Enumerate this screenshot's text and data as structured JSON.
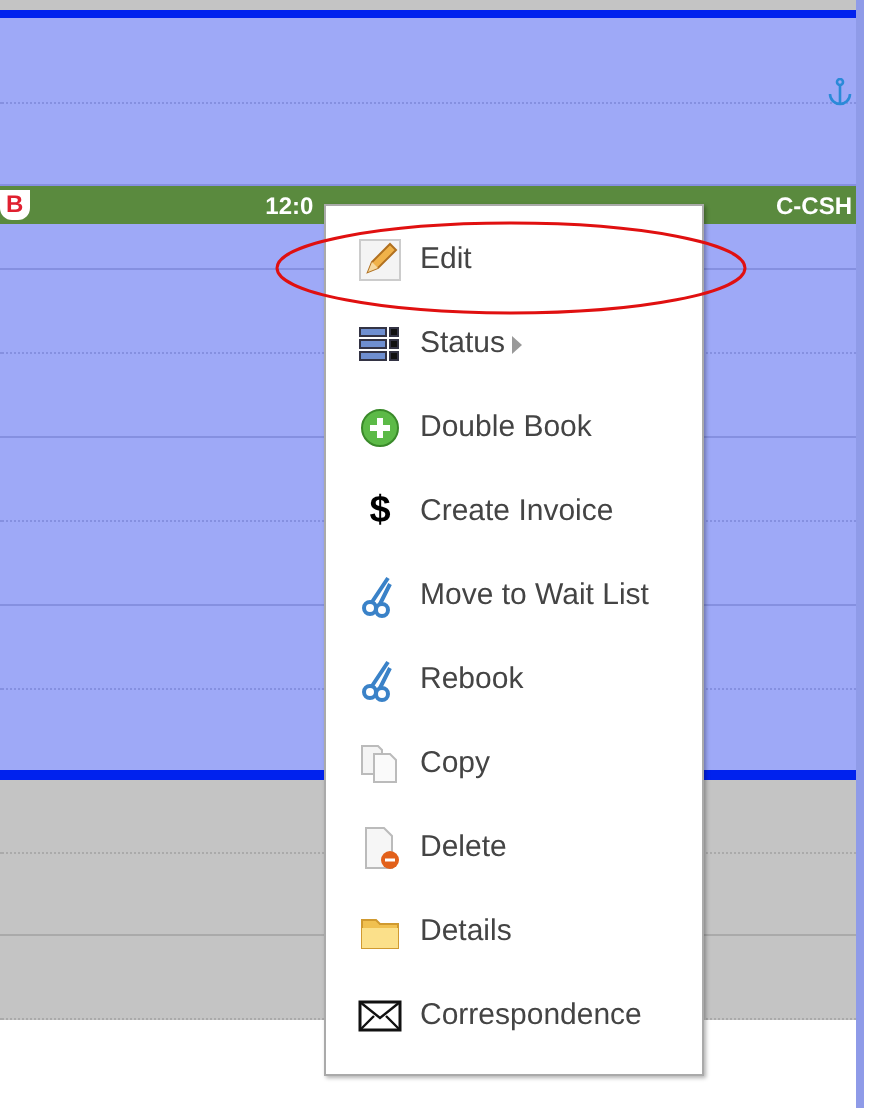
{
  "appointment": {
    "badge": "B",
    "start_time": "12:0",
    "code": "C-CSH"
  },
  "context_menu": {
    "items": [
      {
        "label": "Edit",
        "kind": "pencil",
        "has_submenu": false,
        "circled": true
      },
      {
        "label": "Status",
        "kind": "status",
        "has_submenu": true,
        "circled": false
      },
      {
        "label": "Double Book",
        "kind": "plus",
        "has_submenu": false,
        "circled": false
      },
      {
        "label": "Create Invoice",
        "kind": "glyph",
        "glyph": "$",
        "has_submenu": false,
        "circled": false
      },
      {
        "label": "Move to Wait List",
        "kind": "scissors",
        "has_submenu": false,
        "circled": false
      },
      {
        "label": "Rebook",
        "kind": "scissors",
        "has_submenu": false,
        "circled": false
      },
      {
        "label": "Copy",
        "kind": "copy",
        "has_submenu": false,
        "circled": false
      },
      {
        "label": "Delete",
        "kind": "delete",
        "has_submenu": false,
        "circled": false
      },
      {
        "label": "Details",
        "kind": "folder",
        "has_submenu": false,
        "circled": false
      },
      {
        "label": "Correspondence",
        "kind": "envelope",
        "has_submenu": false,
        "circled": false
      }
    ]
  }
}
